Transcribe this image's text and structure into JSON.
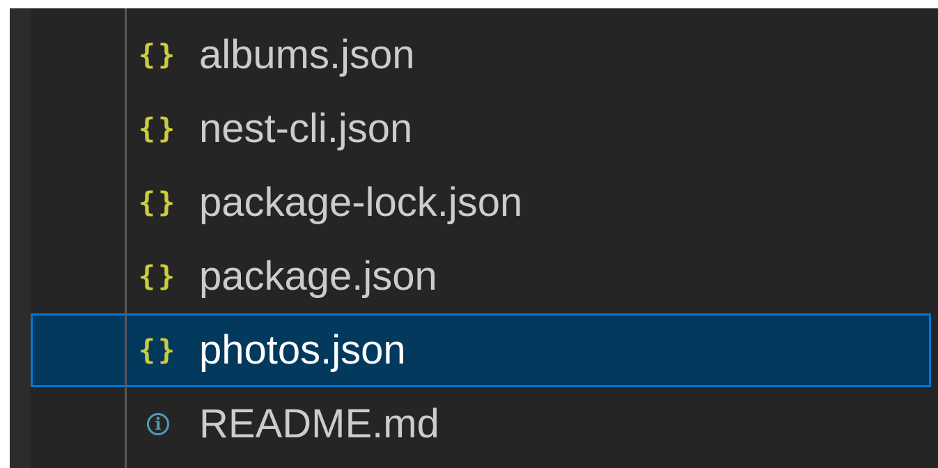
{
  "explorer": {
    "files": [
      {
        "name": "albums.json",
        "icon": "json-file-icon",
        "glyph": "{}",
        "selected": false
      },
      {
        "name": "nest-cli.json",
        "icon": "json-file-icon",
        "glyph": "{}",
        "selected": false
      },
      {
        "name": "package-lock.json",
        "icon": "json-file-icon",
        "glyph": "{}",
        "selected": false
      },
      {
        "name": "package.json",
        "icon": "json-file-icon",
        "glyph": "{}",
        "selected": false
      },
      {
        "name": "photos.json",
        "icon": "json-file-icon",
        "glyph": "{}",
        "selected": true
      },
      {
        "name": "README.md",
        "icon": "info-icon",
        "glyph": "i",
        "selected": false
      }
    ],
    "colors": {
      "background": "#252526",
      "selection_background": "#04395e",
      "selection_border": "#0078d4",
      "json_icon": "#cbcb41",
      "info_icon": "#519aba",
      "label": "#cccccc",
      "selected_label": "#ffffff"
    }
  }
}
